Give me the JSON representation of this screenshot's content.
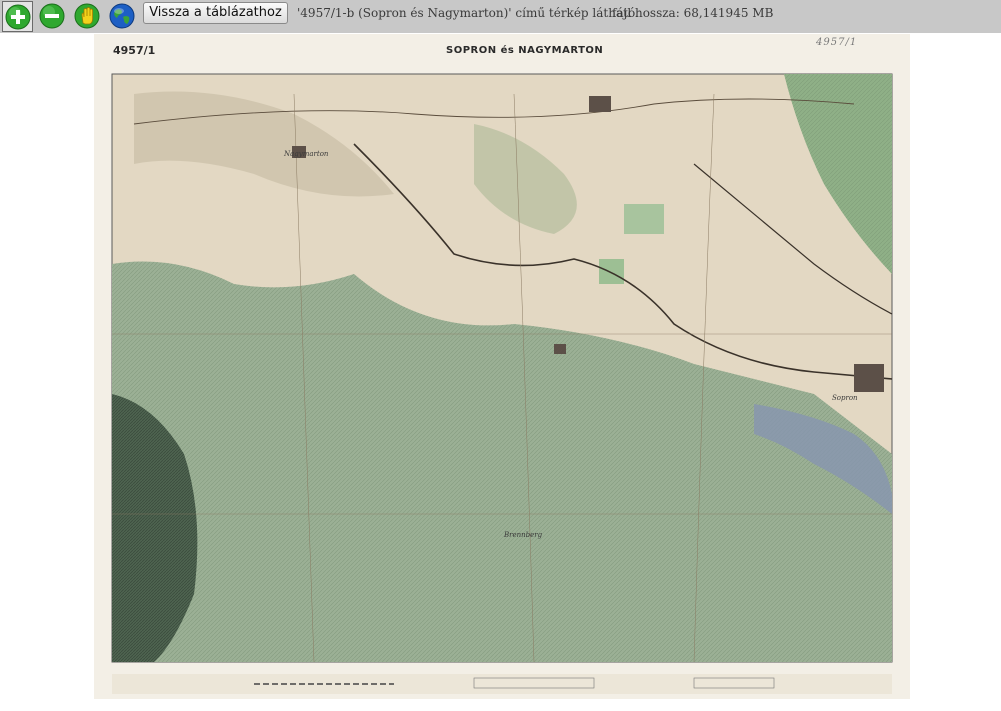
{
  "toolbar": {
    "zoom_in_icon": "plus-circle-icon",
    "zoom_out_icon": "minus-circle-icon",
    "pan_icon": "hand-icon",
    "globe_icon": "globe-icon",
    "back_label": "Vissza a táblázathoz",
    "caption": "'4957/1-b (Sopron és Nagymarton)' című térkép látható.",
    "file_size": "fájl hossza: 68,141945 MB",
    "colors": {
      "bar": "#c8c8c8",
      "zoom_in": "#2fa82f",
      "zoom_out": "#2fa82f",
      "pan": "#e3c81a"
    }
  },
  "map": {
    "sheet_number": "4957/1",
    "title": "SOPRON és NAGYMARTON",
    "handwritten_mark": "4957/1",
    "place_labels": [
      "Nagymarton",
      "Sopron",
      "Brennberg"
    ],
    "colors": {
      "paper": "#e8dfcc",
      "forest": "#8ea889",
      "dark_forest": "#4e6450",
      "water": "#5a6f94",
      "road": "#4a4036"
    }
  }
}
